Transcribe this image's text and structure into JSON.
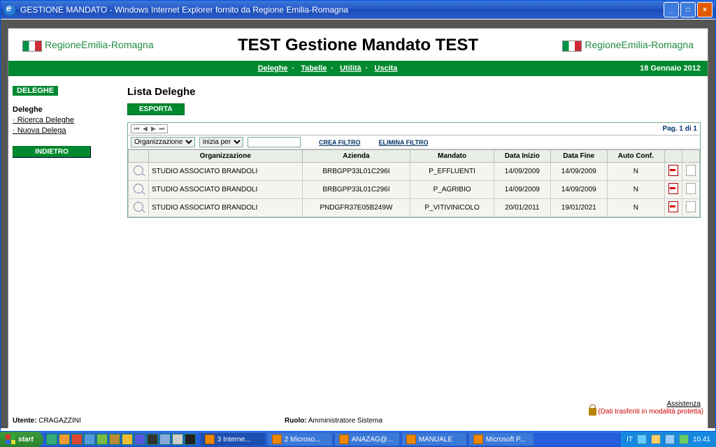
{
  "window": {
    "title": "GESTIONE MANDATO - Windows Internet Explorer fornito da Regione Emilia-Romagna"
  },
  "app": {
    "logo_text": "RegioneEmilia-Romagna",
    "title": "TEST Gestione Mandato TEST",
    "date": "18 Gennaio 2012",
    "menu": {
      "deleghe": "Deleghe",
      "tabelle": "Tabelle",
      "utilita": "Utilità",
      "uscita": "Uscita"
    }
  },
  "sidebar": {
    "section_label": "DELEGHE",
    "group": "Deleghe",
    "links": [
      "Ricerca Deleghe",
      "Nuova Delega"
    ],
    "back": "INDIETRO"
  },
  "main": {
    "heading": "Lista Deleghe",
    "export": "ESPORTA",
    "pager": "Pag. 1 di 1",
    "filter": {
      "field_options": [
        "Organizzazione"
      ],
      "field_selected": "Organizzazione",
      "op_options": [
        "inizia per"
      ],
      "op_selected": "inizia per",
      "value": "",
      "create": "CREA FILTRO",
      "delete": "ELIMINA FILTRO"
    },
    "columns": [
      "Organizzazione",
      "Azienda",
      "Mandato",
      "Data Inizio",
      "Data Fine",
      "Auto Conf."
    ],
    "rows": [
      {
        "org": "STUDIO ASSOCIATO BRANDOLI",
        "az": "BRBGPP33L01C296I",
        "man": "P_EFFLUENTI",
        "di": "14/09/2009",
        "df": "14/09/2009",
        "ac": "N"
      },
      {
        "org": "STUDIO ASSOCIATO BRANDOLI",
        "az": "BRBGPP33L01C296I",
        "man": "P_AGRIBIO",
        "di": "14/09/2009",
        "df": "14/09/2009",
        "ac": "N"
      },
      {
        "org": "STUDIO ASSOCIATO BRANDOLI",
        "az": "PNDGFR37E05B249W",
        "man": "P_VITIVINICOLO",
        "di": "20/01/2011",
        "df": "19/01/2021",
        "ac": "N"
      }
    ]
  },
  "footer": {
    "assistenza": "Assistenza",
    "utente_label": "Utente:",
    "utente": "CRAGAZZINI",
    "ruolo_label": "Ruolo:",
    "ruolo": "Amministratore Sistema",
    "secure": "(Dati trasferiti in modalità protetta)"
  },
  "taskbar": {
    "start": "start",
    "tasks": [
      {
        "label": "3 Interne...",
        "active": true
      },
      {
        "label": "2 Microso..."
      },
      {
        "label": "ANAZAG@..."
      },
      {
        "label": "MANUALE"
      },
      {
        "label": "Microsoft P..."
      }
    ],
    "lang": "IT",
    "clock": "10.41"
  }
}
